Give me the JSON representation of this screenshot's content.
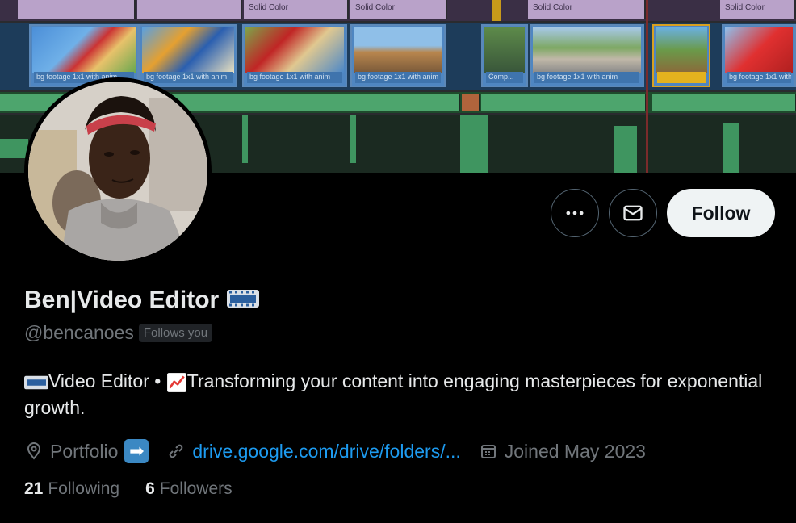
{
  "banner": {
    "timeline_label": "Solid Color",
    "clip_caption": "bg footage 1x1 with anim",
    "clip_caption_short": "Comp..."
  },
  "profile": {
    "name": "Ben|Video Editor",
    "name_emoji_icon": "film-frames-icon",
    "handle": "@bencanoes",
    "follows_you_badge": "Follows you",
    "bio_part1": "Video Editor • ",
    "bio_part2": "Transforming your content into engaging masterpieces for exponential growth.",
    "location": "Portfolio",
    "link": "drive.google.com/drive/folders/...",
    "joined": "Joined May 2023",
    "following_count": "21",
    "following_label": "Following",
    "followers_count": "6",
    "followers_label": "Followers"
  },
  "actions": {
    "follow_label": "Follow",
    "more_icon": "more-dots-icon",
    "message_icon": "envelope-icon"
  },
  "colors": {
    "background": "#000000",
    "link": "#1d9bf0",
    "muted": "#71767b",
    "follow_button_bg": "#eff3f4"
  }
}
